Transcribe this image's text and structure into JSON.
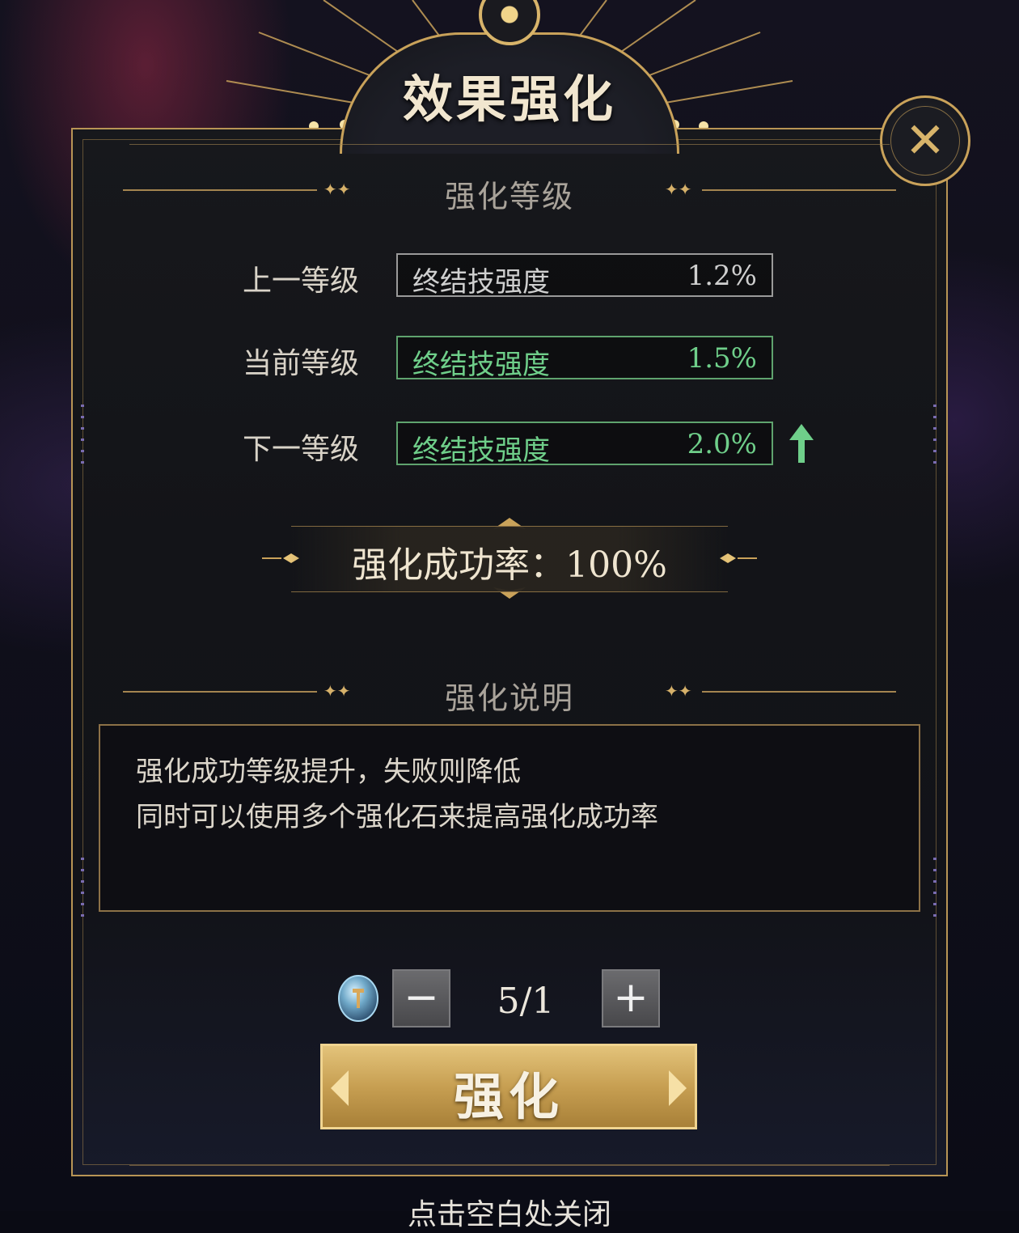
{
  "dialog": {
    "title": "效果强化",
    "close_icon": "close-x-icon"
  },
  "level_section": {
    "title": "强化等级",
    "rows": [
      {
        "label": "上一等级",
        "stat_name": "终结技强度",
        "stat_value": "1.2%",
        "state": "previous"
      },
      {
        "label": "当前等级",
        "stat_name": "终结技强度",
        "stat_value": "1.5%",
        "state": "current"
      },
      {
        "label": "下一等级",
        "stat_name": "终结技强度",
        "stat_value": "2.0%",
        "state": "next"
      }
    ],
    "next_indicator_icon": "up-arrow-icon"
  },
  "success_rate": {
    "text": "强化成功率：100%"
  },
  "description_section": {
    "title": "强化说明",
    "lines": [
      "强化成功等级提升，失败则降低",
      "同时可以使用多个强化石来提高强化成功率"
    ]
  },
  "material": {
    "icon": "enhance-stone-icon",
    "minus_label": "−",
    "count": "5/1",
    "plus_label": "+"
  },
  "enhance_button": {
    "label": "强化"
  },
  "hint": "点击空白处关闭",
  "colors": {
    "gold": "#c9a25a",
    "green": "#6fcf8a",
    "panel": "#131418"
  }
}
